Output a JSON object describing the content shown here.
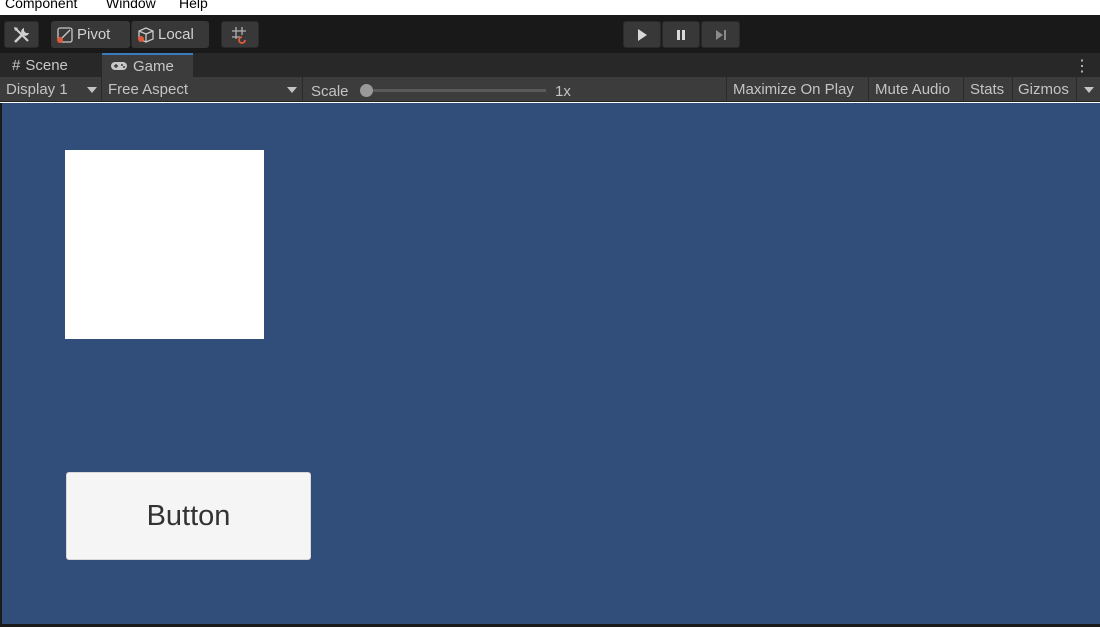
{
  "menu": {
    "items": [
      "Component",
      "Window",
      "Help"
    ]
  },
  "toolbar": {
    "tools_icon": "tools-icon",
    "pivot_label": "Pivot",
    "local_label": "Local",
    "grid_snap_icon": "grid-snap-icon",
    "play_icon": "play-icon",
    "pause_icon": "pause-icon",
    "step_icon": "step-icon"
  },
  "tabs": [
    {
      "label": "Scene",
      "icon": "hash-icon"
    },
    {
      "label": "Game",
      "icon": "gamepad-icon"
    }
  ],
  "game_toolbar": {
    "display": "Display 1",
    "aspect": "Free Aspect",
    "scale_label": "Scale",
    "scale_value": "1x",
    "scale_level": 0,
    "maximize": "Maximize On Play",
    "mute": "Mute Audio",
    "stats": "Stats",
    "gizmos": "Gizmos"
  },
  "viewport": {
    "background": "#314d79",
    "button_label": "Button"
  }
}
